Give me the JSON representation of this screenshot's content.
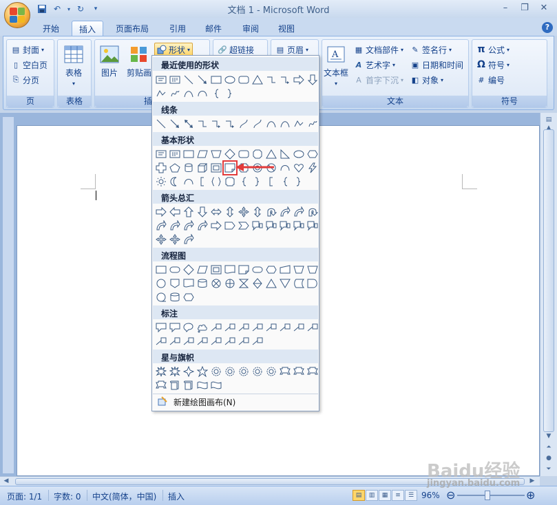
{
  "window": {
    "title": "文档 1 - Microsoft Word"
  },
  "qat": {
    "items": [
      "save-icon",
      "undo-icon",
      "redo-icon",
      "customize-icon"
    ]
  },
  "tabs": [
    {
      "label": "开始"
    },
    {
      "label": "插入",
      "active": true
    },
    {
      "label": "页面布局"
    },
    {
      "label": "引用"
    },
    {
      "label": "邮件"
    },
    {
      "label": "审阅"
    },
    {
      "label": "视图"
    }
  ],
  "ribbon": {
    "pages": {
      "label": "页",
      "cover": "封面",
      "blank": "空白页",
      "break": "分页"
    },
    "tables": {
      "label": "表格",
      "table": "表格"
    },
    "illustrations": {
      "label": "插图",
      "picture": "图片",
      "clipart": "剪贴画",
      "shapes": "形状"
    },
    "links": {
      "hyperlink": "超链接"
    },
    "header": {
      "header": "页眉"
    },
    "text": {
      "label": "文本",
      "textbox": "文本框",
      "quickparts": "文档部件",
      "wordart": "艺术字",
      "dropcap": "首字下沉",
      "signature": "签名行",
      "datetime": "日期和时间",
      "object": "对象"
    },
    "symbols": {
      "label": "符号",
      "equation": "公式",
      "symbol": "符号",
      "number": "编号"
    }
  },
  "shapes_menu": {
    "sections": {
      "recent": "最近使用的形状",
      "lines": "线条",
      "basic": "基本形状",
      "arrows": "箭头总汇",
      "flowchart": "流程图",
      "callouts": "标注",
      "stars": "星与旗帜"
    },
    "footer": "新建绘图画布(N)"
  },
  "status": {
    "page": "页面: 1/1",
    "words": "字数: 0",
    "language": "中文(简体，中国)",
    "mode": "插入",
    "zoom": "96%"
  },
  "watermark": {
    "brand": "Baidu经验",
    "url": "jingyan.baidu.com"
  }
}
